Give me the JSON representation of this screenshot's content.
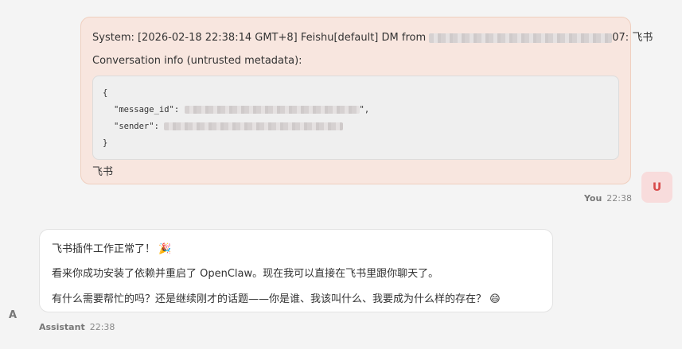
{
  "user_message": {
    "system_prefix": "System: [2026-02-18 22:38:14 GMT+8] Feishu[default] DM from",
    "system_suffix": "07: 飞书",
    "conversation_info": "Conversation info (untrusted metadata):",
    "code": {
      "open_brace": "{",
      "message_id_key": "\"message_id\":",
      "message_id_tail": "\",",
      "sender_key": "\"sender\":",
      "close_brace": "}"
    },
    "body_text": "飞书"
  },
  "user": {
    "avatar_letter": "U",
    "name": "You",
    "time": "22:38"
  },
  "assistant_message": {
    "line1": "飞书插件工作正常了！",
    "line1_emoji": "🎉",
    "line2": "看来你成功安装了依赖并重启了 OpenClaw。现在我可以直接在飞书里跟你聊天了。",
    "line3": "有什么需要帮忙的吗？还是继续刚才的话题——你是谁、我该叫什么、我要成为什么样的存在？",
    "line3_emoji": "😄"
  },
  "assistant": {
    "avatar_letter": "A",
    "name": "Assistant",
    "time": "22:38"
  }
}
